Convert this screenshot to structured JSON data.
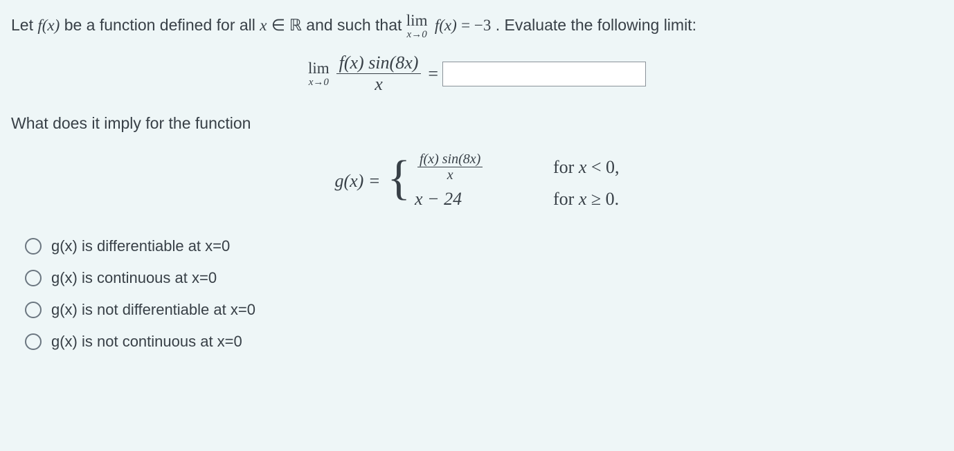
{
  "intro": {
    "part1": "Let ",
    "f_of_x": "f(x)",
    "part2": " be a function defined for all ",
    "x_in_R_x": "x",
    "elem": " ∈ ",
    "R": "ℝ",
    "part3": " and such that ",
    "lim_label": "lim",
    "lim_sub": "x→0",
    "lim_fx": "f(x)",
    "eq_neg3": " = −3",
    "part4": ". Evaluate the following limit:"
  },
  "main_limit": {
    "lim_label": "lim",
    "lim_sub": "x→0",
    "numerator": "f(x) sin(8x)",
    "denominator": "x",
    "equals": "="
  },
  "answer_placeholder": "",
  "subquestion": "What does it imply for the function",
  "gx": {
    "lhs": "g(x) = ",
    "case1_num": "f(x) sin(8x)",
    "case1_den": "x",
    "case1_cond": "for x < 0,",
    "case2_expr": "x − 24",
    "case2_cond": "for x ≥ 0."
  },
  "options": [
    "g(x) is differentiable at x=0",
    "g(x) is continuous at x=0",
    "g(x) is not differentiable at x=0",
    "g(x) is not continuous at x=0"
  ]
}
